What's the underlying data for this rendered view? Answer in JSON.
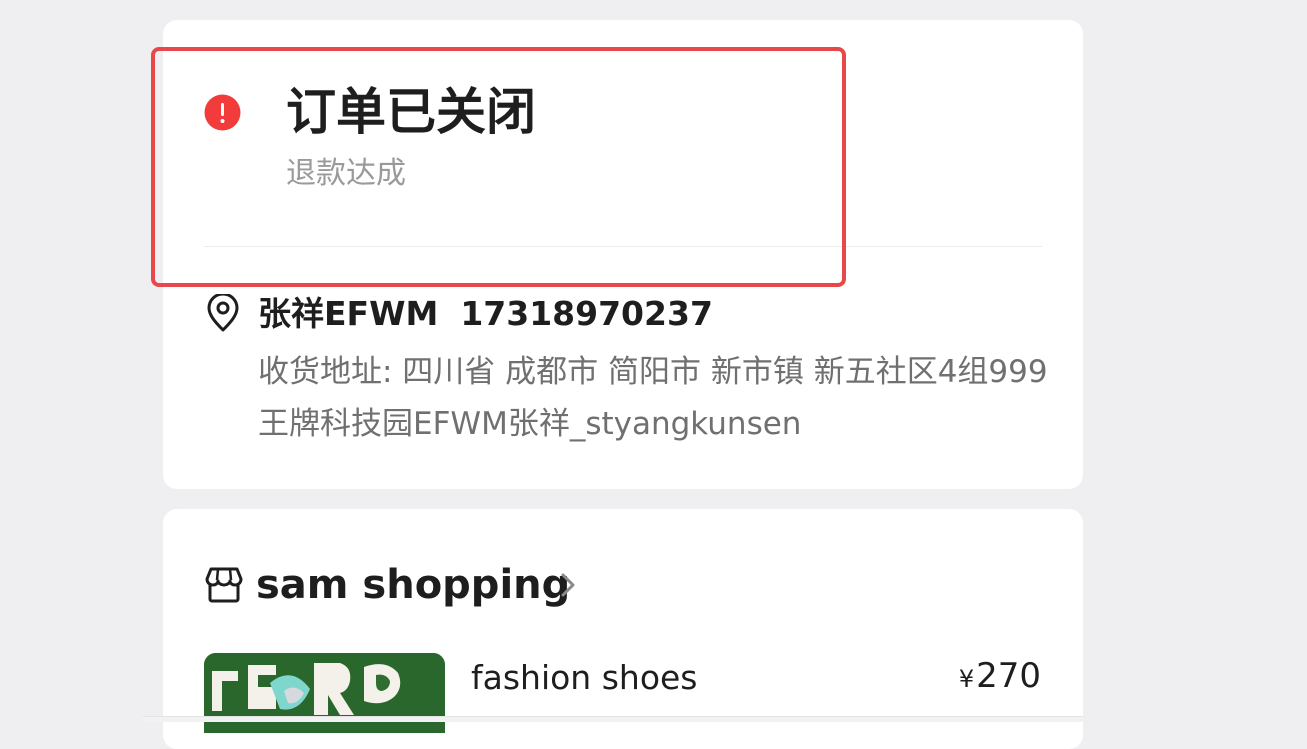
{
  "order_status": {
    "title": "订单已关闭",
    "subtitle": "退款达成",
    "icon": "alert-circle-icon",
    "icon_color": "#f23c3c"
  },
  "shipping": {
    "icon": "location-pin-icon",
    "name": "张祥EFWM",
    "phone": "17318970237",
    "address": "收货地址: 四川省 成都市 简阳市 新市镇 新五社区4组999王牌科技园EFWM张祥_styangkunsen"
  },
  "shop": {
    "icon": "store-icon",
    "name": "sam shopping",
    "chevron_icon": "chevron-right-icon"
  },
  "product": {
    "name": "fashion shoes",
    "currency": "¥",
    "price": "270"
  },
  "colors": {
    "highlight": "#e8484a",
    "background": "#efeff1"
  }
}
